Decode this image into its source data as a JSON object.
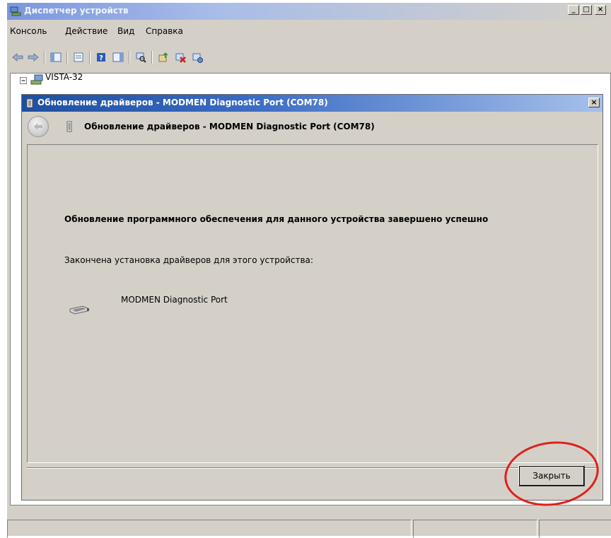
{
  "main_window": {
    "title": "Диспетчер устройств",
    "caption_buttons": {
      "minimize": "_",
      "maximize": "□",
      "close": "×"
    }
  },
  "menu": [
    "Консоль",
    "Действие",
    "Вид",
    "Справка"
  ],
  "toolbar": {
    "icons": [
      "back-icon",
      "forward-icon",
      "show-hide-tree-icon",
      "properties-icon",
      "help-icon",
      "action-pane-icon",
      "scan-hardware-icon",
      "update-driver-icon",
      "uninstall-icon",
      "disable-icon"
    ]
  },
  "tree": {
    "root": "VISTA-32"
  },
  "dialog": {
    "title": "Обновление драйверов - MODMEN Diagnostic Port (COM78)",
    "header": "Обновление драйверов - MODMEN Diagnostic Port (COM78)",
    "success_heading": "Обновление программного обеспечения для данного устройства завершено успешно",
    "finish_text": "Закончена установка драйверов для этого устройства:",
    "device_name": "MODMEN Diagnostic Port",
    "close_button": "Закрыть",
    "close_x": "×"
  },
  "annotation": {
    "color": "#e0201c",
    "target": "close-button"
  }
}
